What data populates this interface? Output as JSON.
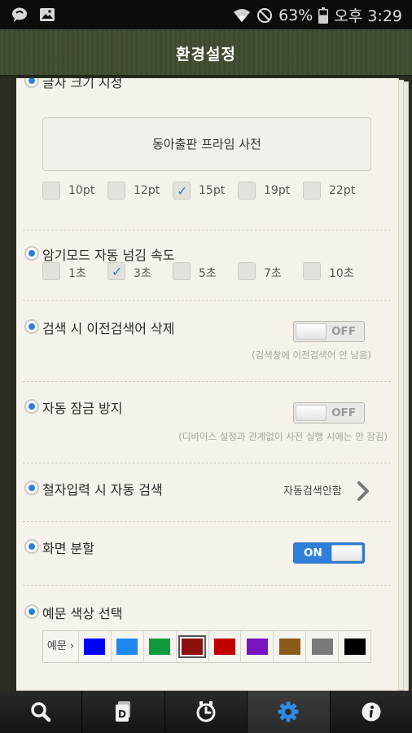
{
  "status_bar": {
    "battery": "63%",
    "time": "오후 3:29"
  },
  "header": {
    "title": "환경설정"
  },
  "font_section": {
    "label": "글자 크기 지정",
    "dictionary": "동아출판 프라임 사전",
    "sizes": [
      {
        "label": "10pt",
        "checked": false
      },
      {
        "label": "12pt",
        "checked": false
      },
      {
        "label": "15pt",
        "checked": true
      },
      {
        "label": "19pt",
        "checked": false
      },
      {
        "label": "22pt",
        "checked": false
      }
    ]
  },
  "memorize": {
    "label": "암기모드 자동 넘김 속도",
    "options": [
      {
        "label": "1초",
        "checked": false
      },
      {
        "label": "3초",
        "checked": true
      },
      {
        "label": "5초",
        "checked": false
      },
      {
        "label": "7초",
        "checked": false
      },
      {
        "label": "10초",
        "checked": false
      }
    ]
  },
  "delete_history": {
    "label": "검색 시 이전검색어 삭제",
    "toggle": "OFF",
    "hint": "(검색창에 이전검색어 안 남음)"
  },
  "prevent_lock": {
    "label": "자동 잠금 방지",
    "toggle": "OFF",
    "hint": "(디바이스 설정과 관계없이 사전 실행 시에는 안 잠김)"
  },
  "auto_search": {
    "label": "철자입력 시 자동 검색",
    "value": "자동검색안함"
  },
  "split_screen": {
    "label": "화면 분할",
    "toggle": "ON"
  },
  "example_color": {
    "label": "예문 색상 선택",
    "prefix": "예문 ›",
    "colors": [
      "#0000ff",
      "#1e88f0",
      "#0f9a3c",
      "#8b1010",
      "#c00000",
      "#7a14c0",
      "#8b5a1b",
      "#7a7a7a",
      "#000000"
    ],
    "selected_index": 3
  },
  "bottom_nav": [
    "search-icon",
    "dictionary-icon",
    "history-icon",
    "settings-icon",
    "info-icon"
  ],
  "colors": {
    "accent": "#2e7cd8",
    "title_bar": "#414c31"
  }
}
